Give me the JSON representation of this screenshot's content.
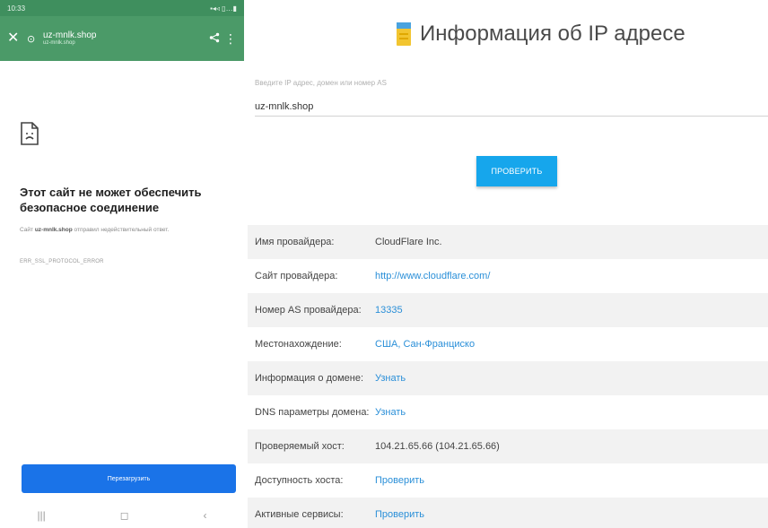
{
  "phone": {
    "status_bar": {
      "time": "10:33",
      "icons": "▪◂◃ ▯…▮"
    },
    "app_bar": {
      "close_icon": "close-icon",
      "url_main": "uz-mnlk.shop",
      "url_sub": "uz-mnlk.shop",
      "share_icon": "share-icon",
      "more_icon": "more-vert-icon"
    },
    "error": {
      "icon": "broken-page-icon",
      "title": "Этот сайт не может обеспечить безопасное соединение",
      "desc_prefix": "Сайт",
      "desc_site": "uz-mnlk.shop",
      "desc_suffix": "отправил недействительный ответ.",
      "code": "ERR_SSL_PROTOCOL_ERROR"
    },
    "reload_label": "Перезагрузить",
    "nav": {
      "recent": "|||",
      "home": "◻",
      "back": "‹"
    }
  },
  "web": {
    "title": "Информация об IP адресе",
    "input_label": "Введите IP адрес, домен или номер AS",
    "input_value": "uz-mnlk.shop",
    "check_label": "ПРОВЕРИТЬ",
    "rows": [
      {
        "label": "Имя провайдера:",
        "value": "CloudFlare Inc.",
        "link": false
      },
      {
        "label": "Сайт провайдера:",
        "value": "http://www.cloudflare.com/",
        "link": true
      },
      {
        "label": "Номер AS провайдера:",
        "value": "13335",
        "link": true
      },
      {
        "label": "Местонахождение:",
        "value": "США, Сан-Франциско",
        "link": true
      },
      {
        "label": "Информация о домене:",
        "value": "Узнать",
        "link": true
      },
      {
        "label": "DNS параметры домена:",
        "value": "Узнать",
        "link": true
      },
      {
        "label": "Проверяемый хост:",
        "value": "104.21.65.66 (104.21.65.66)",
        "link": false
      },
      {
        "label": "Доступность хоста:",
        "value": "Проверить",
        "link": true
      },
      {
        "label": "Активные сервисы:",
        "value": "Проверить",
        "link": true
      }
    ]
  },
  "colors": {
    "phone_status_bar": "#3f8f5e",
    "phone_app_bar": "#4b9a68",
    "reload_button": "#1a73e8",
    "check_button": "#16a6ec",
    "link": "#2a8fd8",
    "row_stripe": "#f2f2f2"
  }
}
